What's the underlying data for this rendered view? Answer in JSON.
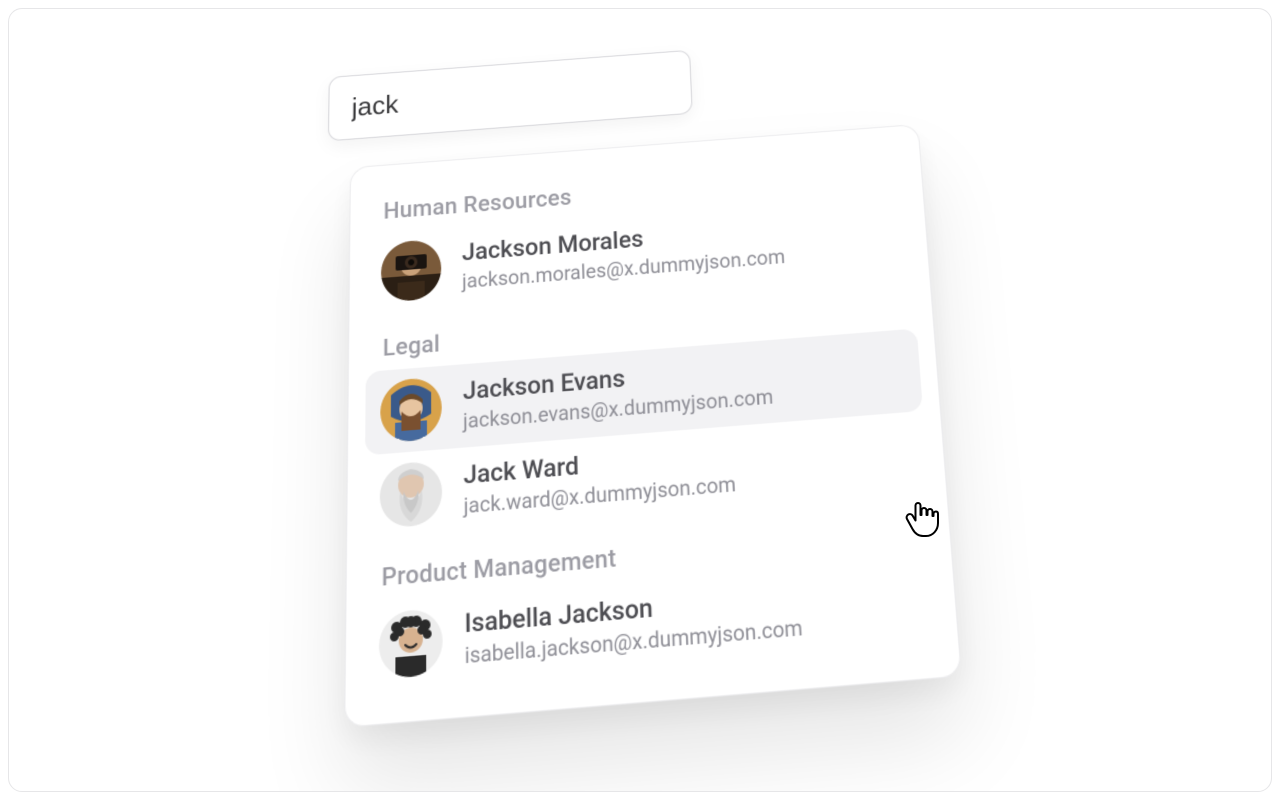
{
  "search": {
    "value": "jack",
    "placeholder": ""
  },
  "groups": [
    {
      "label": "Human Resources",
      "items": [
        {
          "name": "Jackson Morales",
          "email": "jackson.morales@x.dummyjson.com",
          "hovered": false,
          "avatar": "photographer"
        }
      ]
    },
    {
      "label": "Legal",
      "items": [
        {
          "name": "Jackson Evans",
          "email": "jackson.evans@x.dummyjson.com",
          "hovered": true,
          "avatar": "hooded-woman"
        },
        {
          "name": "Jack Ward",
          "email": "jack.ward@x.dummyjson.com",
          "hovered": false,
          "avatar": "bearded-man"
        }
      ]
    },
    {
      "label": "Product Management",
      "items": [
        {
          "name": "Isabella Jackson",
          "email": "isabella.jackson@x.dummyjson.com",
          "hovered": false,
          "avatar": "curly-person"
        }
      ]
    }
  ]
}
